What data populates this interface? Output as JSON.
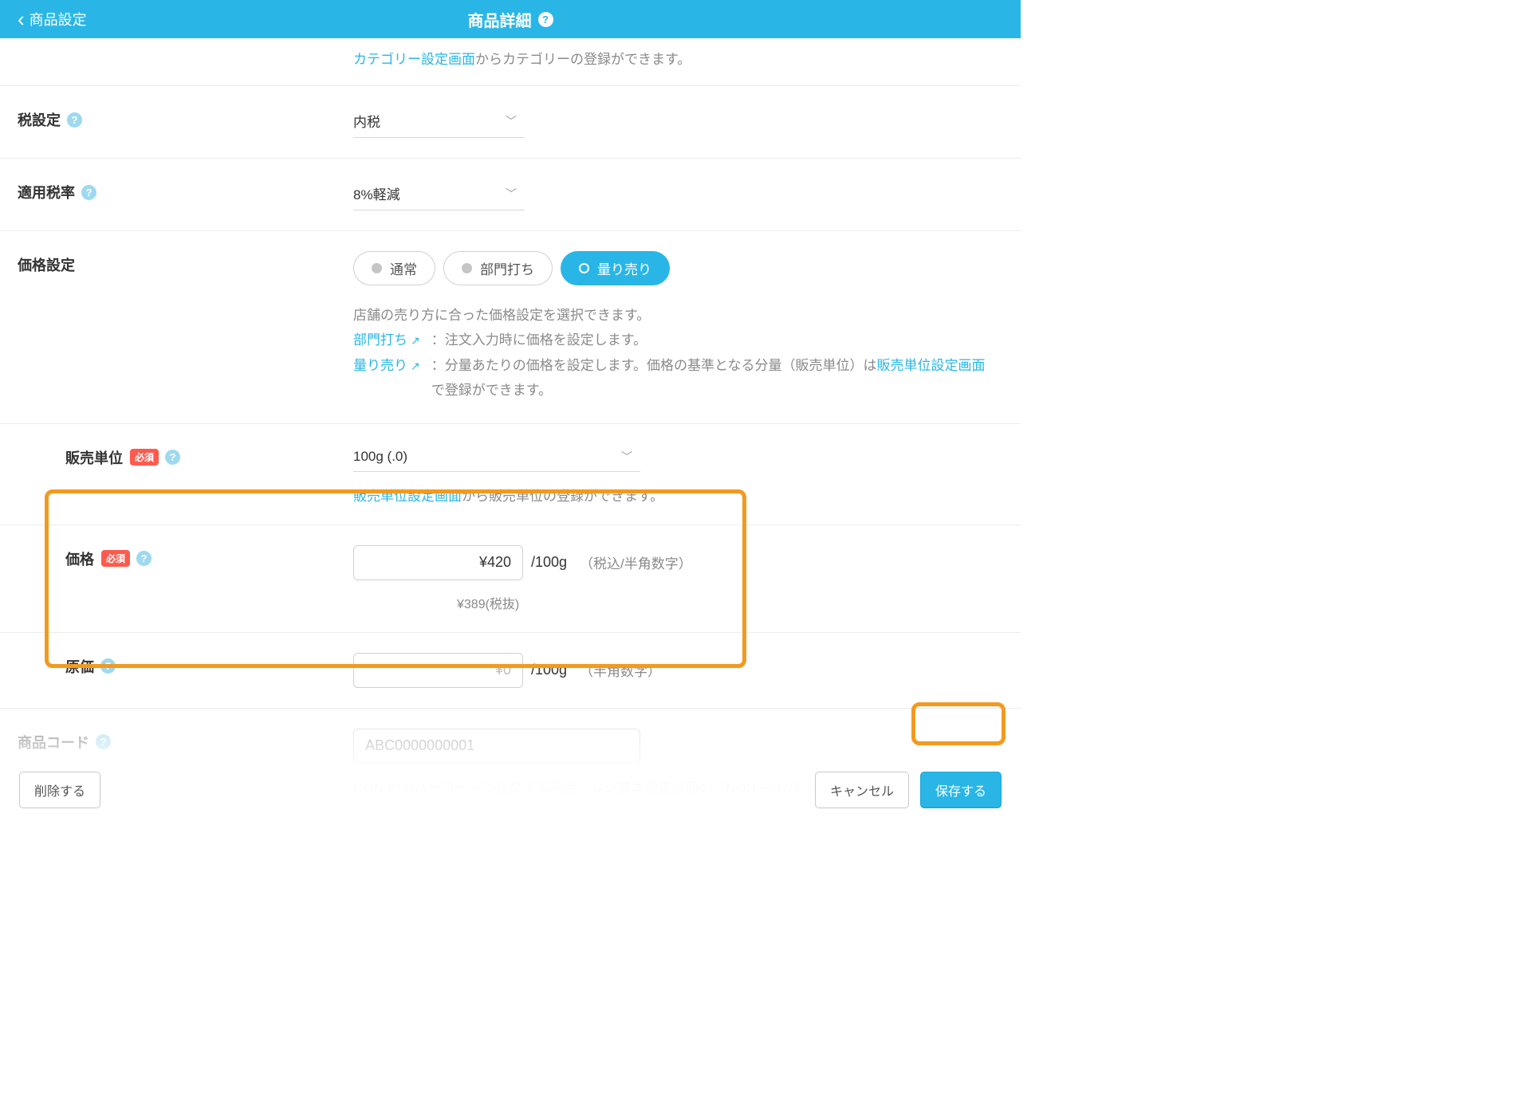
{
  "header": {
    "back": "商品設定",
    "title": "商品詳細"
  },
  "category_hint": {
    "link": "カテゴリー設定画面",
    "rest": "からカテゴリーの登録ができます。"
  },
  "tax_setting": {
    "label": "税設定",
    "value": "内税"
  },
  "tax_rate": {
    "label": "適用税率",
    "value": "8%軽減"
  },
  "price_mode": {
    "label": "価格設定",
    "options": {
      "normal": "通常",
      "dept": "部門打ち",
      "weigh": "量り売り"
    },
    "desc_lead": "店舗の売り方に合った価格設定を選択できます。",
    "dept_link": "部門打ち",
    "dept_desc": "：注文入力時に価格を設定します。",
    "weigh_link": "量り売り",
    "weigh_desc_a": "：分量あたりの価格を設定します。価格の基準となる分量（販売単位）は",
    "weigh_unit_link": "販売単位設定画面",
    "weigh_desc_b": "で登録ができます。"
  },
  "sale_unit": {
    "label": "販売単位",
    "required": "必須",
    "value": "100g (.0)",
    "hint_link": "販売単位設定画面",
    "hint_rest": "から販売単位の登録ができます。"
  },
  "price": {
    "label": "価格",
    "required": "必須",
    "value": "¥420",
    "unit": "/100g",
    "paren": "（税込/半角数字）",
    "sub": "¥389(税抜)"
  },
  "cost": {
    "label": "原価",
    "placeholder": "¥0",
    "unit": "/100g",
    "paren": "（半角数字）"
  },
  "prod_code": {
    "label": "商品コード",
    "placeholder": "ABC0000000001",
    "hint_a": "NON-PLUバーコードで注文する場合、レジ基本設定画面の「NON-PLUバーコード」"
  },
  "footer": {
    "delete": "削除する",
    "cancel": "キャンセル",
    "save": "保存する"
  }
}
